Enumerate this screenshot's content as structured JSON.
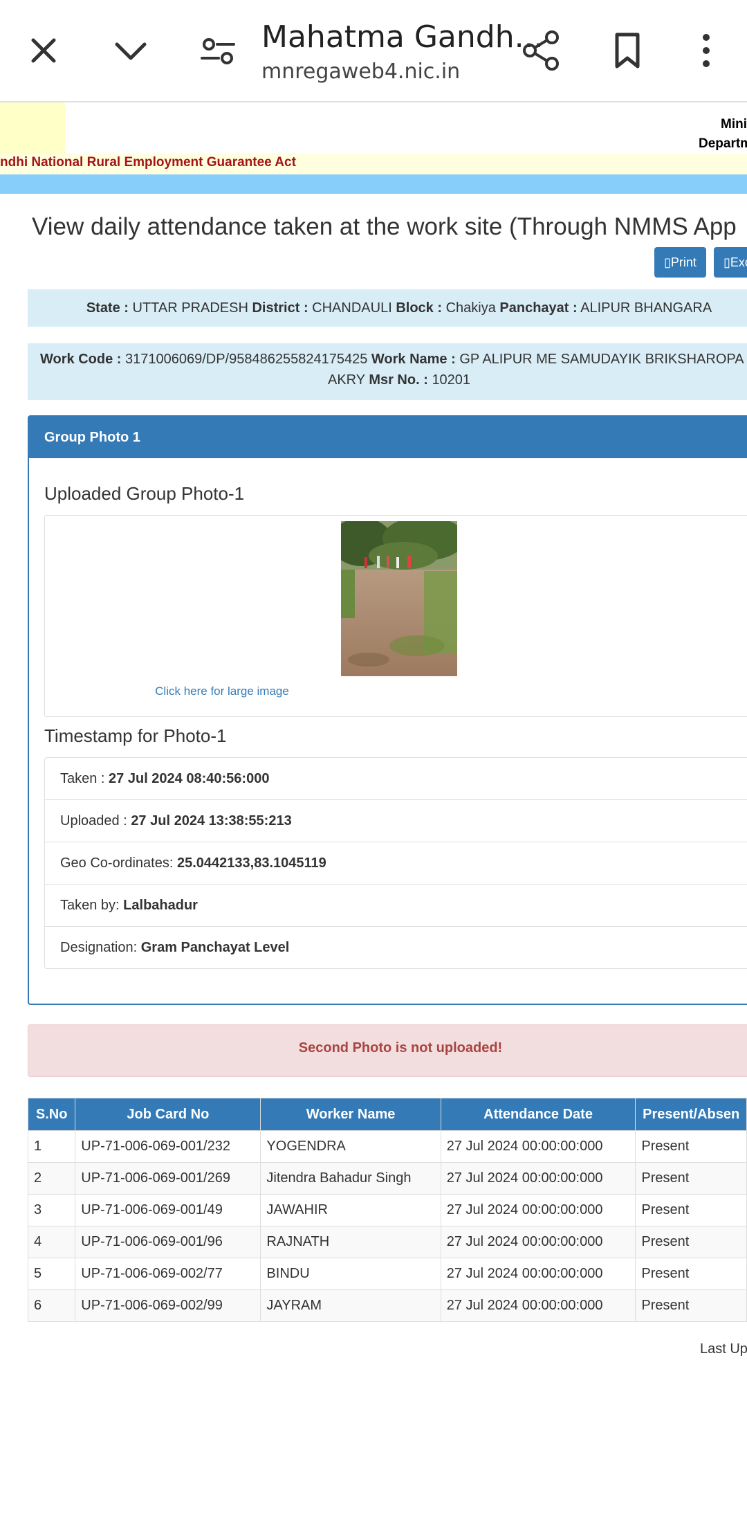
{
  "browser": {
    "title": "Mahatma Gandh...",
    "url": "mnregaweb4.nic.in"
  },
  "header": {
    "ministry_line1": "Mini",
    "ministry_line2": "Departm",
    "act_text": "ndhi National Rural Employment Guarantee Act"
  },
  "page": {
    "title": "View daily attendance taken at the work site (Through NMMS App",
    "print_button": "▯Print",
    "excel_button": "▯Exc"
  },
  "location": {
    "state_label": "State :",
    "state": "UTTAR PRADESH",
    "district_label": "District :",
    "district": "CHANDAULI",
    "block_label": "Block :",
    "block": "Chakiya",
    "panchayat_label": "Panchayat :",
    "panchayat": "ALIPUR BHANGARA"
  },
  "work": {
    "code_label": "Work Code :",
    "code": "3171006069/DP/958486255824175425",
    "name_label": "Work Name :",
    "name_line1": "GP ALIPUR ME SAMUDAYIK BRIKSHAROPA",
    "name_line2": "AKRY",
    "msr_label": "Msr No. :",
    "msr": "10201"
  },
  "group_photo": {
    "panel_title": "Group Photo 1",
    "uploaded_heading": "Uploaded Group Photo-1",
    "large_image_link": "Click here for large image",
    "timestamp_heading": "Timestamp for Photo-1",
    "taken_label": "Taken :",
    "taken": "27 Jul 2024 08:40:56:000",
    "uploaded_label": "Uploaded :",
    "uploaded": "27 Jul 2024 13:38:55:213",
    "geo_label": "Geo Co-ordinates:",
    "geo": "25.0442133,83.1045119",
    "taken_by_label": "Taken by:",
    "taken_by": "Lalbahadur",
    "designation_label": "Designation:",
    "designation": "Gram Panchayat Level"
  },
  "alert": {
    "message": "Second Photo is not uploaded!"
  },
  "table": {
    "headers": [
      "S.No",
      "Job Card No",
      "Worker Name",
      "Attendance Date",
      "Present/Absen"
    ],
    "rows": [
      [
        "1",
        "UP-71-006-069-001/232",
        "YOGENDRA",
        "27 Jul 2024 00:00:00:000",
        "Present"
      ],
      [
        "2",
        "UP-71-006-069-001/269",
        "Jitendra Bahadur Singh",
        "27 Jul 2024 00:00:00:000",
        "Present"
      ],
      [
        "3",
        "UP-71-006-069-001/49",
        "JAWAHIR",
        "27 Jul 2024 00:00:00:000",
        "Present"
      ],
      [
        "4",
        "UP-71-006-069-001/96",
        "RAJNATH",
        "27 Jul 2024 00:00:00:000",
        "Present"
      ],
      [
        "5",
        "UP-71-006-069-002/77",
        "BINDU",
        "27 Jul 2024 00:00:00:000",
        "Present"
      ],
      [
        "6",
        "UP-71-006-069-002/99",
        "JAYRAM",
        "27 Jul 2024 00:00:00:000",
        "Present"
      ]
    ]
  },
  "footer": {
    "last_updated": "Last Up"
  },
  "colors": {
    "primary": "#337ab7",
    "info_bg": "#d9edf7",
    "alert_bg": "#f2dede",
    "alert_text": "#a94442",
    "act_text": "#a31515",
    "sky_strip": "#87cefa"
  },
  "icons": {
    "close": "close-icon",
    "dropdown": "chevron-down-icon",
    "site_settings": "tune-icon",
    "share": "share-icon",
    "bookmark": "bookmark-icon",
    "menu": "more-vert-icon"
  }
}
